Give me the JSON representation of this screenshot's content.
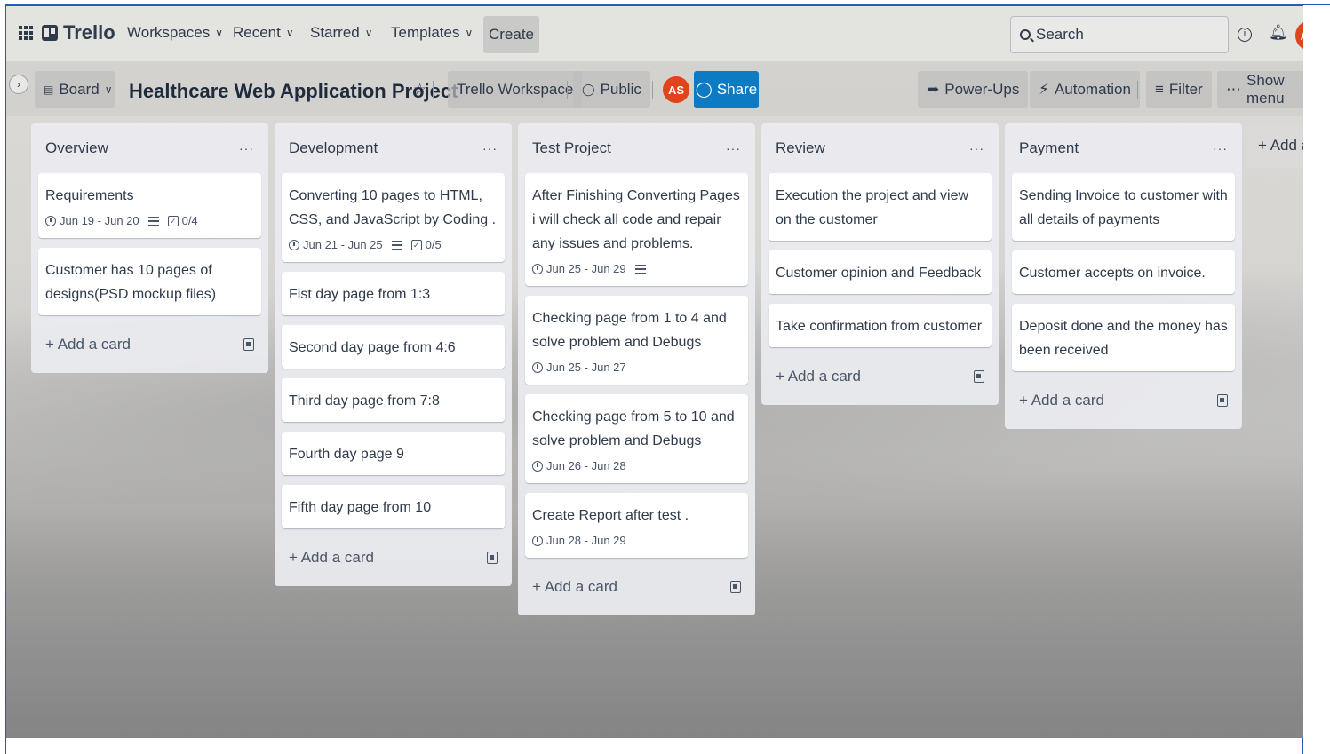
{
  "nav": {
    "logo": "Trello",
    "workspaces": "Workspaces",
    "recent": "Recent",
    "starred": "Starred",
    "templates": "Templates",
    "create": "Create",
    "search_placeholder": "Search",
    "avatar_initials": "AS"
  },
  "board": {
    "view_label": "Board",
    "title": "Healthcare Web Application Project",
    "workspace": "Trello Workspace",
    "visibility": "Public",
    "member_initials": "AS",
    "share": "Share",
    "powerups": "Power-Ups",
    "automation": "Automation",
    "filter": "Filter",
    "show_menu": "Show menu",
    "add_another": "+ Add ano"
  },
  "lists": [
    {
      "title": "Overview",
      "add_card": "Add a card",
      "cards": [
        {
          "title": "Requirements",
          "date": "Jun 19 - Jun 20",
          "description": true,
          "checklist": "0/4"
        },
        {
          "title": "Customer has 10 pages of designs(PSD mockup files)"
        }
      ]
    },
    {
      "title": "Development",
      "add_card": "Add a card",
      "cards": [
        {
          "title": "Converting 10 pages to HTML, CSS, and JavaScript by Coding .",
          "date": "Jun 21 - Jun 25",
          "description": true,
          "checklist": "0/5"
        },
        {
          "title": "Fist day page from 1:3"
        },
        {
          "title": "Second day page from 4:6"
        },
        {
          "title": "Third day page from 7:8"
        },
        {
          "title": "Fourth day page 9"
        },
        {
          "title": "Fifth day page from 10"
        }
      ]
    },
    {
      "title": "Test Project",
      "add_card": "Add a card",
      "cards": [
        {
          "title": "After Finishing Converting Pages i will check all code and repair any issues and problems.",
          "date": "Jun 25 - Jun 29",
          "description": true
        },
        {
          "title": "Checking page from 1 to 4 and solve problem and Debugs",
          "date": "Jun 25 - Jun 27"
        },
        {
          "title": "Checking page from 5 to 10 and solve problem and Debugs",
          "date": "Jun 26 - Jun 28"
        },
        {
          "title": "Create Report after test .",
          "date": "Jun 28 - Jun 29"
        }
      ]
    },
    {
      "title": "Review",
      "add_card": "Add a card",
      "cards": [
        {
          "title": "Execution the project and view on the customer"
        },
        {
          "title": "Customer opinion and Feedback"
        },
        {
          "title": "Take confirmation from customer"
        }
      ]
    },
    {
      "title": "Payment",
      "add_card": "Add a card",
      "cards": [
        {
          "title": "Sending Invoice to customer with all details of payments"
        },
        {
          "title": "Customer accepts on invoice."
        },
        {
          "title": "Deposit done and the money has been received"
        }
      ]
    }
  ],
  "colors": {
    "accent": "#0c7bc4",
    "avatar": "#e0441b",
    "list_bg": "#ebecf0"
  }
}
